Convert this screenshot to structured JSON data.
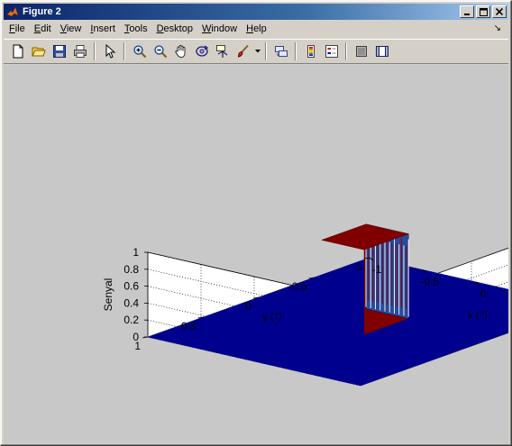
{
  "window": {
    "title": "Figure 2",
    "minimize_glyph": "_",
    "maximize_glyph": "□",
    "close_glyph": "✕"
  },
  "menu": {
    "items": [
      {
        "label": "File",
        "ul": "F",
        "rest": "ile"
      },
      {
        "label": "Edit",
        "ul": "E",
        "rest": "dit"
      },
      {
        "label": "View",
        "ul": "V",
        "rest": "iew"
      },
      {
        "label": "Insert",
        "ul": "I",
        "rest": "nsert"
      },
      {
        "label": "Tools",
        "ul": "T",
        "rest": "ools"
      },
      {
        "label": "Desktop",
        "ul": "D",
        "rest": "esktop"
      },
      {
        "label": "Window",
        "ul": "W",
        "rest": "indow"
      },
      {
        "label": "Help",
        "ul": "H",
        "rest": "elp"
      }
    ],
    "dock_arrow": "↘"
  },
  "toolbar": {
    "tools": [
      "new-figure-icon",
      "open-file-icon",
      "save-icon",
      "print-icon",
      "edit-plot-arrow-icon",
      "zoom-in-icon",
      "zoom-out-icon",
      "pan-hand-icon",
      "rotate-3d-icon",
      "data-cursor-icon",
      "brush-icon",
      "link-plot-icon",
      "colorbar-icon",
      "legend-icon",
      "hide-plot-tools-icon",
      "show-plot-tools-icon"
    ]
  },
  "chart_data": {
    "type": "surface-3d",
    "title": "",
    "xlabel": "x (°)",
    "ylabel": "y (°)",
    "zlabel": "Senyal",
    "xlim": [
      -1,
      1
    ],
    "ylim": [
      -1,
      1
    ],
    "zlim": [
      0,
      1
    ],
    "xticks": [
      "-1",
      "-0.5",
      "0",
      "0.5",
      "1"
    ],
    "yticks": [
      "-1",
      "-0.5",
      "0",
      "0.5",
      "1"
    ],
    "zticks": [
      "0",
      "0.2",
      "0.4",
      "0.6",
      "0.8",
      "1"
    ],
    "grid": true,
    "surface": {
      "description_values": "rectangular pulse",
      "pulse_x_range": [
        -0.2,
        0.2
      ],
      "pulse_y_range": [
        -0.2,
        0.2
      ],
      "pulse_height": 1,
      "base_height": 0
    },
    "colors": {
      "base": "#00008f",
      "pulse_top": "#800000",
      "pulse_mid": "#2a4b9b",
      "background": "#c8c8c8",
      "axes_face": "#ffffff"
    }
  }
}
